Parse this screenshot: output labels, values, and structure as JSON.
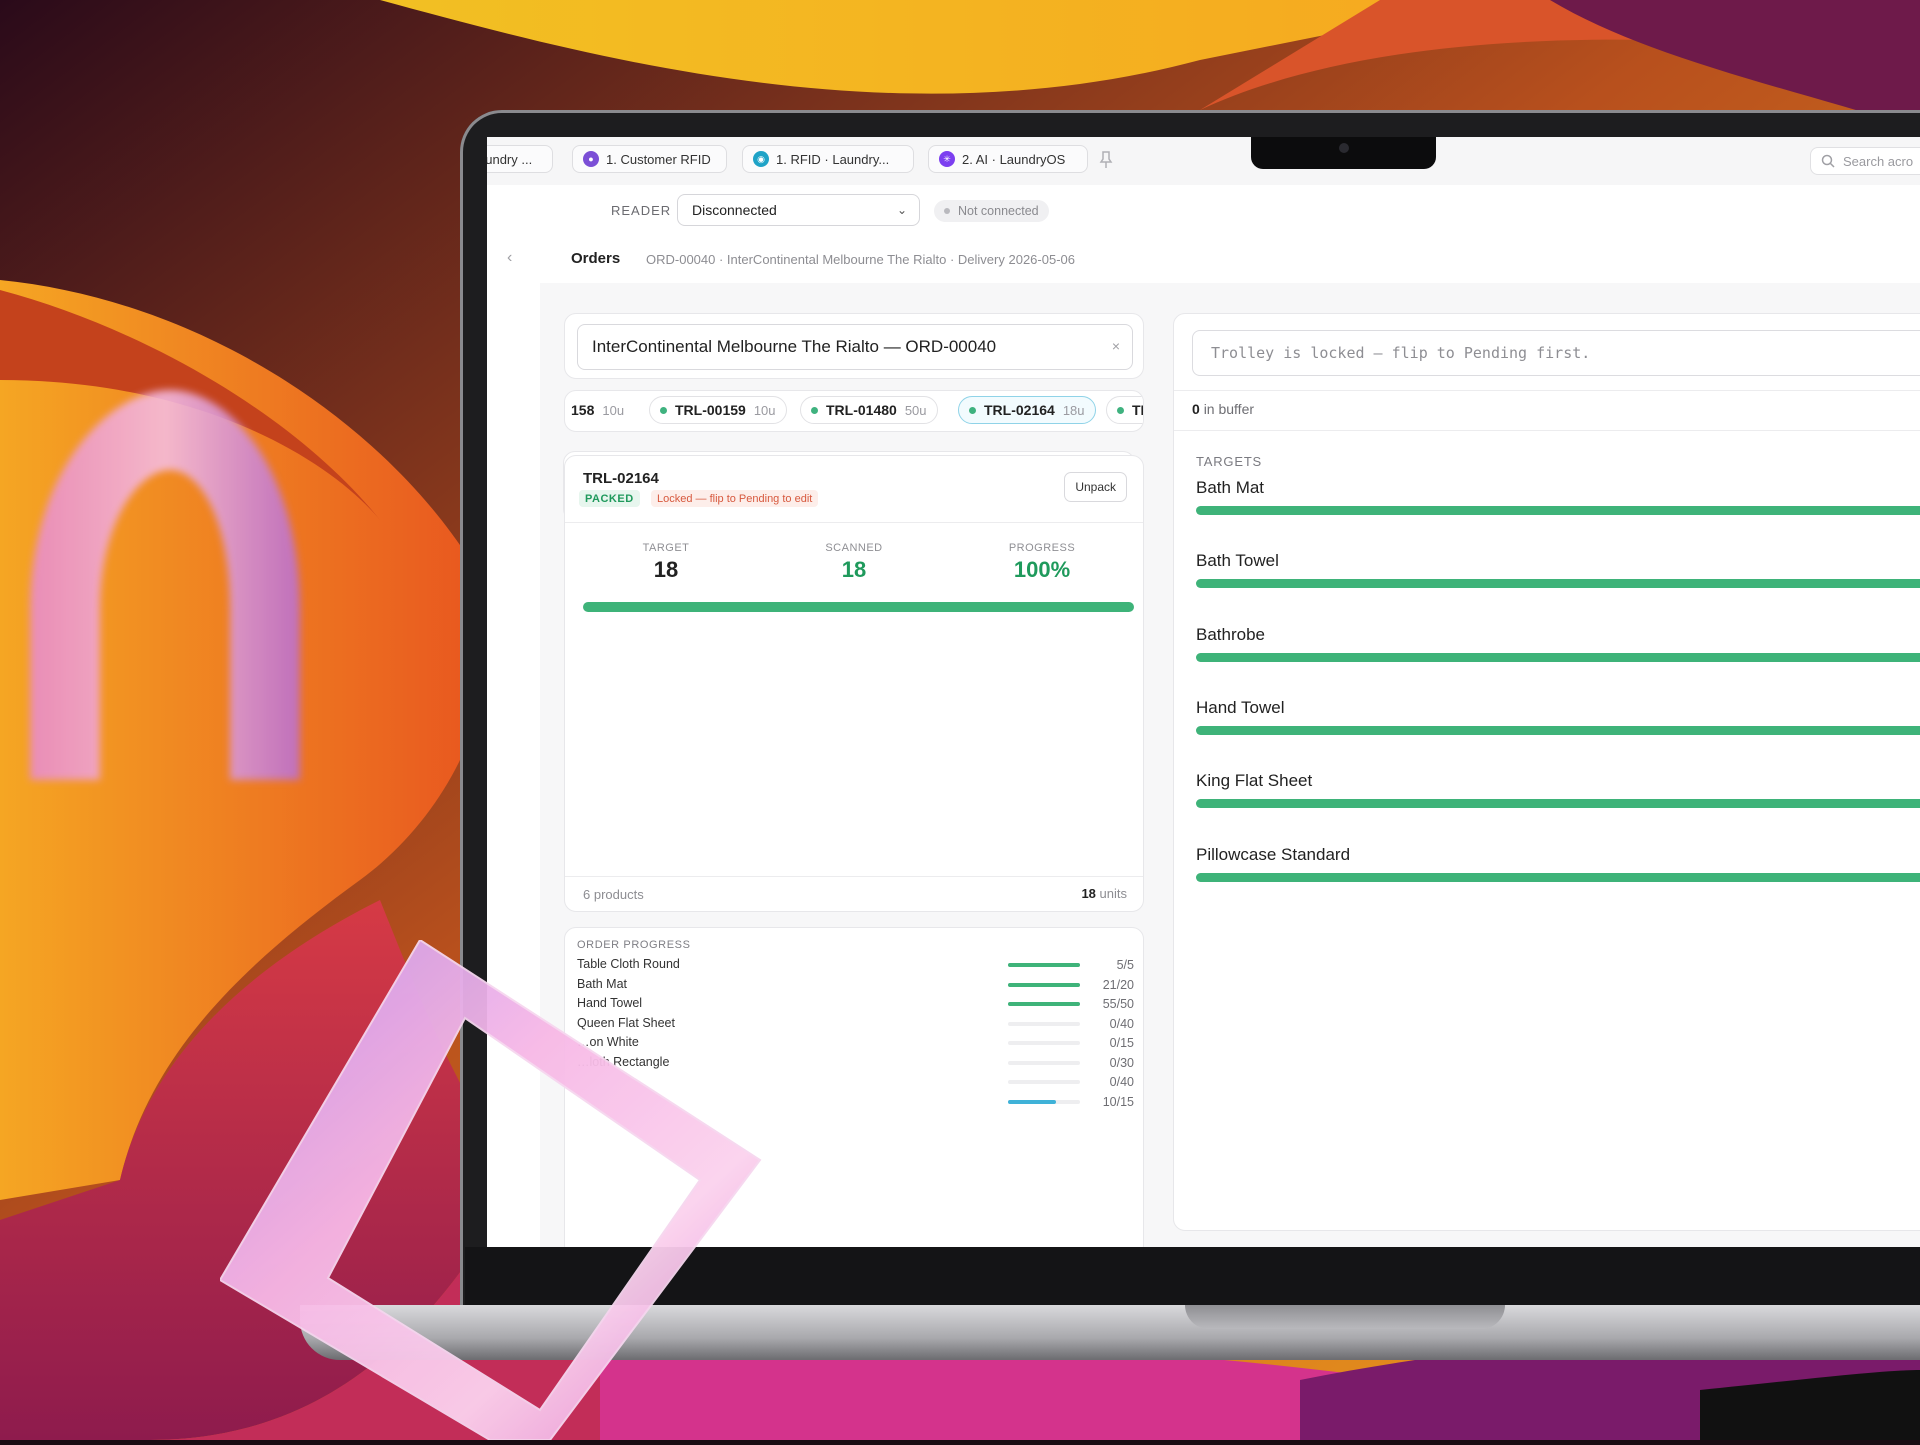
{
  "browser": {
    "tabs": [
      {
        "label": "aundry ...",
        "icon": "app-icon"
      },
      {
        "label": "1. Customer RFID",
        "icon": "purple-app-icon"
      },
      {
        "label": "1. RFID · Laundry...",
        "icon": "eye-app-icon"
      },
      {
        "label": "2. AI · LaundryOS",
        "icon": "sparkle-app-icon"
      }
    ],
    "search_placeholder": "Search acro"
  },
  "reader": {
    "label": "READER",
    "selected": "Disconnected",
    "status": "Not connected"
  },
  "breadcrumb": {
    "title": "Orders",
    "subtitle": "ORD-00040 · InterContinental Melbourne The Rialto · Delivery 2026-05-06"
  },
  "order_search": {
    "value": "InterContinental Melbourne The Rialto — ORD-00040",
    "clear": "×"
  },
  "trolleys": [
    {
      "id": "158",
      "units": "10u",
      "dot": false,
      "active": false
    },
    {
      "id": "TRL-00159",
      "units": "10u",
      "dot": true,
      "active": false
    },
    {
      "id": "TRL-01480",
      "units": "50u",
      "dot": true,
      "active": false
    },
    {
      "id": "TRL-02164",
      "units": "18u",
      "dot": true,
      "active": true
    },
    {
      "id": "TF",
      "units": "",
      "dot": true,
      "active": false
    }
  ],
  "trolley_card": {
    "id": "TRL-02164",
    "status": "PACKED",
    "locked_note": "Locked — flip to Pending to edit",
    "unpack_label": "Unpack",
    "target_label": "TARGET",
    "target": "18",
    "scanned_label": "SCANNED",
    "scanned": "18",
    "progress_label": "PROGRESS",
    "progress": "100%",
    "progress_fraction": 1.0,
    "products": "6 products",
    "units_value": "18",
    "units_label": "units"
  },
  "order_progress": {
    "title": "ORDER PROGRESS",
    "rows": [
      {
        "name": "Table Cloth Round",
        "count": "5/5",
        "fraction": 1.0,
        "color": "#3eb379"
      },
      {
        "name": "Bath Mat",
        "count": "21/20",
        "fraction": 1.0,
        "color": "#3eb379"
      },
      {
        "name": "Hand Towel",
        "count": "55/50",
        "fraction": 1.0,
        "color": "#3eb379"
      },
      {
        "name": "Queen Flat Sheet",
        "count": "0/40",
        "fraction": 0,
        "color": "#3eb379"
      },
      {
        "name": "…on White",
        "count": "0/15",
        "fraction": 0,
        "color": "#3eb379"
      },
      {
        "name": "…loth Rectangle",
        "count": "0/30",
        "fraction": 0,
        "color": "#3eb379"
      },
      {
        "name": "",
        "count": "0/40",
        "fraction": 0,
        "color": "#3eb379"
      },
      {
        "name": "",
        "count": "10/15",
        "fraction": 0.67,
        "color": "#3fb2d8"
      }
    ]
  },
  "scanner": {
    "message": "Trolley is locked — flip to Pending first.",
    "buffer_count": "0",
    "buffer_label": "in buffer",
    "targets_label": "TARGETS",
    "targets": [
      {
        "name": "Bath Mat",
        "fraction": 1.0
      },
      {
        "name": "Bath Towel",
        "fraction": 1.0
      },
      {
        "name": "Bathrobe",
        "fraction": 1.0
      },
      {
        "name": "Hand Towel",
        "fraction": 1.0
      },
      {
        "name": "King Flat Sheet",
        "fraction": 1.0
      },
      {
        "name": "Pillowcase Standard",
        "fraction": 1.0
      }
    ]
  },
  "colors": {
    "accent_green": "#3eb379",
    "accent_cyan": "#3fb2d8",
    "locked_red": "#d7593e"
  }
}
